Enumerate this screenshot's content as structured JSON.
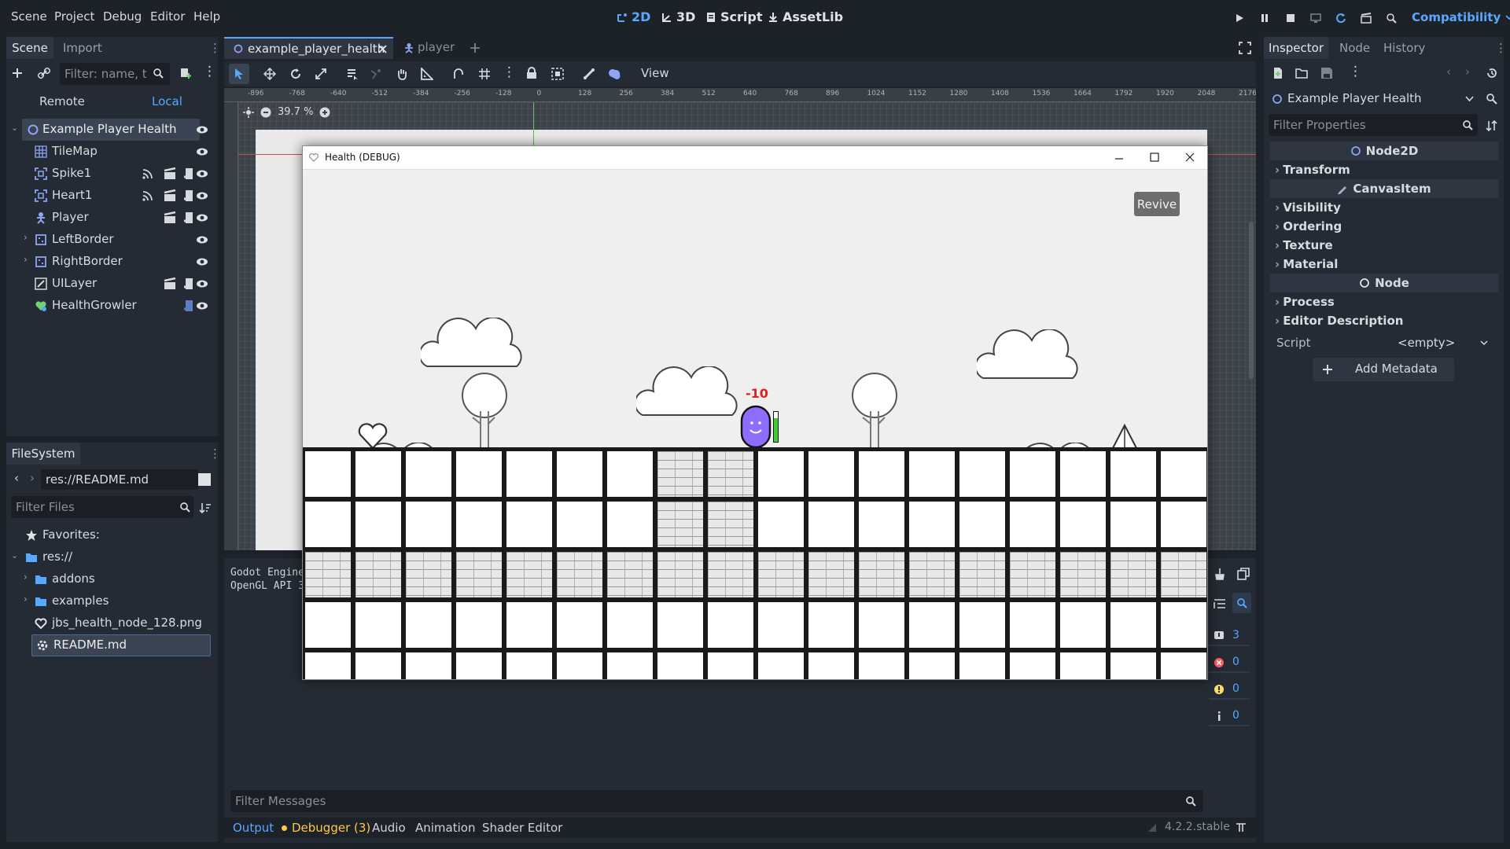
{
  "menu": {
    "scene": "Scene",
    "project": "Project",
    "debug": "Debug",
    "editor": "Editor",
    "help": "Help"
  },
  "modes": {
    "m2d": "2D",
    "m3d": "3D",
    "script": "Script",
    "assetlib": "AssetLib"
  },
  "renderer": "Compatibility",
  "scene_panel": {
    "tab_scene": "Scene",
    "tab_import": "Import",
    "filter_placeholder": "Filter: name, t:t",
    "remote": "Remote",
    "local": "Local",
    "nodes": [
      {
        "label": "Example Player Health",
        "icon": "node2d-icon"
      },
      {
        "label": "TileMap",
        "icon": "tilemap-icon"
      },
      {
        "label": "Spike1",
        "icon": "area2d-icon"
      },
      {
        "label": "Heart1",
        "icon": "area2d-icon"
      },
      {
        "label": "Player",
        "icon": "character-icon"
      },
      {
        "label": "LeftBorder",
        "icon": "static-body-icon"
      },
      {
        "label": "RightBorder",
        "icon": "static-body-icon"
      },
      {
        "label": "UILayer",
        "icon": "canvas-layer-icon"
      },
      {
        "label": "HealthGrowler",
        "icon": "growler-icon"
      }
    ]
  },
  "filesystem": {
    "tab": "FileSystem",
    "path": "res://README.md",
    "filter_placeholder": "Filter Files",
    "items": [
      {
        "label": "Favorites:"
      },
      {
        "label": "res://"
      },
      {
        "label": "addons"
      },
      {
        "label": "examples"
      },
      {
        "label": "jbs_health_node_128.png"
      },
      {
        "label": "README.md"
      }
    ]
  },
  "editor_tabs": {
    "tab1": "example_player_health",
    "tab2": "player"
  },
  "toolbar": {
    "view": "View"
  },
  "zoom": "39.7 %",
  "ruler_labels": [
    "-896",
    "-768",
    "-640",
    "-512",
    "-384",
    "-256",
    "-128",
    "0",
    "128",
    "256",
    "384",
    "512",
    "640",
    "768",
    "896",
    "1024",
    "1152",
    "1280",
    "1408",
    "1536",
    "1664",
    "1792",
    "1920",
    "2048",
    "2176"
  ],
  "game_window": {
    "title": "Health (DEBUG)",
    "revive": "Revive",
    "damage": "-10",
    "health_fraction": 0.8
  },
  "output": {
    "lines": [
      "Godot Engine",
      "OpenGL API 3"
    ],
    "filter_placeholder": "Filter Messages",
    "counts": {
      "messages": "3",
      "errors": "0",
      "warnings": "0",
      "info": "0"
    }
  },
  "bottom_tabs": {
    "output": "Output",
    "debugger": "Debugger (3)",
    "audio": "Audio",
    "animation": "Animation",
    "shader": "Shader Editor",
    "version": "4.2.2.stable"
  },
  "inspector": {
    "tab_inspector": "Inspector",
    "tab_node": "Node",
    "tab_history": "History",
    "object": "Example Player Health",
    "filter_placeholder": "Filter Properties",
    "sec_node2d": "Node2D",
    "transform": "Transform",
    "sec_canvasitem": "CanvasItem",
    "visibility": "Visibility",
    "ordering": "Ordering",
    "texture": "Texture",
    "material": "Material",
    "sec_node": "Node",
    "process": "Process",
    "editor_description": "Editor Description",
    "script_label": "Script",
    "script_value": "<empty>",
    "add_metadata": "Add Metadata"
  },
  "colors": {
    "accent": "#57a8ff",
    "bg": "#1d2229",
    "panel": "#252b34",
    "player": "#8c6dff",
    "health_bar": "#3ccf32",
    "damage": "#e22020"
  }
}
